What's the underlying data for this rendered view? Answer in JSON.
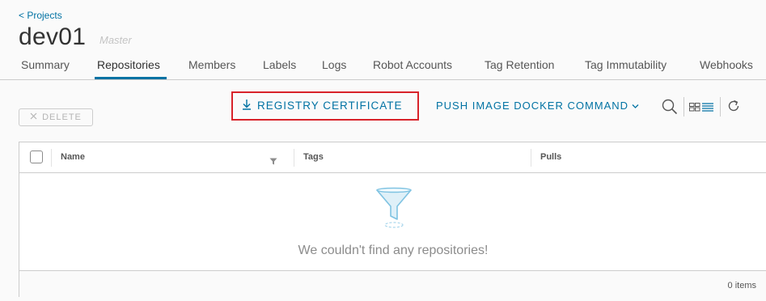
{
  "breadcrumb": {
    "back_label": "< Projects"
  },
  "project": {
    "name": "dev01",
    "role": "Master"
  },
  "tabs": [
    {
      "label": "Summary",
      "active": false
    },
    {
      "label": "Repositories",
      "active": true
    },
    {
      "label": "Members",
      "active": false
    },
    {
      "label": "Labels",
      "active": false
    },
    {
      "label": "Logs",
      "active": false
    },
    {
      "label": "Robot Accounts",
      "active": false
    },
    {
      "label": "Tag Retention",
      "active": false
    },
    {
      "label": "Tag Immutability",
      "active": false
    },
    {
      "label": "Webhooks",
      "active": false
    }
  ],
  "toolbar": {
    "delete_label": "DELETE",
    "registry_cert_label": "REGISTRY CERTIFICATE",
    "push_command_label": "PUSH IMAGE DOCKER COMMAND"
  },
  "table": {
    "columns": [
      "Name",
      "Tags",
      "Pulls"
    ],
    "empty_message": "We couldn't find any repositories!",
    "footer_count": "0 items"
  },
  "colors": {
    "accent": "#0072a3",
    "highlight_border": "#d8232a"
  }
}
